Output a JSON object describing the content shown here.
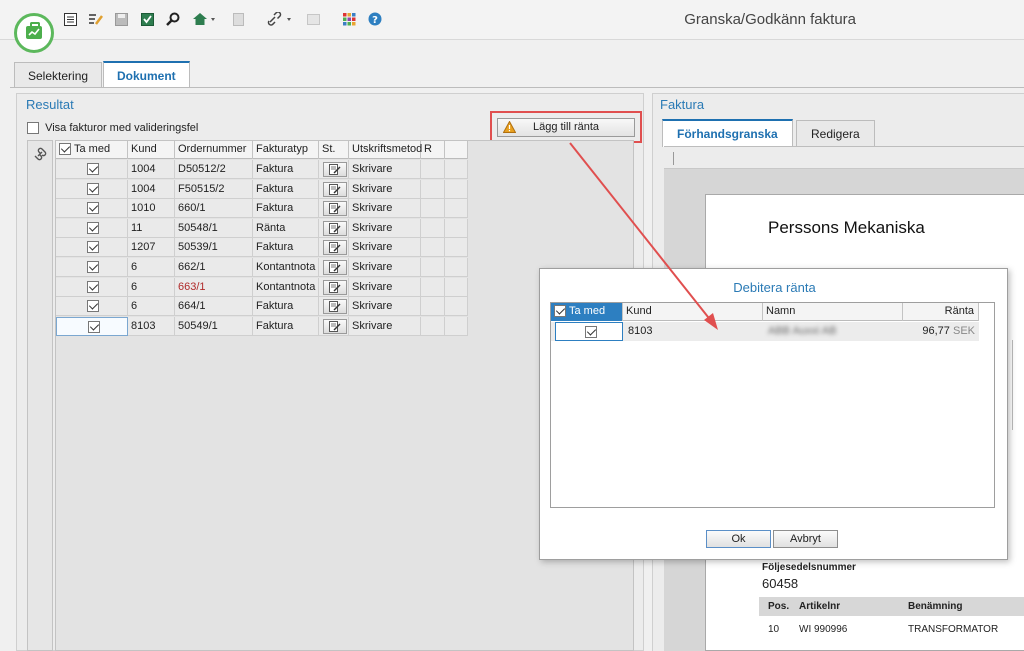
{
  "app": {
    "title": "Granska/Godkänn faktura"
  },
  "toolbar": {
    "icons": [
      "list-icon",
      "edit-list-icon",
      "save-icon",
      "approve-icon",
      "search-icon",
      "home-icon",
      "disabled-icon",
      "link-icon",
      "disabled-icon-2",
      "apps-grid-icon",
      "help-icon"
    ]
  },
  "tabs": {
    "selektering": "Selektering",
    "dokument": "Dokument"
  },
  "resultat": {
    "title": "Resultat",
    "validation_checkbox_label": "Visa fakturor med valideringsfel",
    "add_interest_button": "Lägg till ränta",
    "columns": [
      "Ta med",
      "Kund",
      "Ordernummer",
      "Fakturatyp",
      "St.",
      "Utskriftsmetod",
      "R"
    ],
    "rows": [
      {
        "checked": true,
        "kund": "1004",
        "order": "D50512/2",
        "typ": "Faktura",
        "metod": "Skrivare",
        "order_red": false
      },
      {
        "checked": true,
        "kund": "1004",
        "order": "F50515/2",
        "typ": "Faktura",
        "metod": "Skrivare",
        "order_red": false
      },
      {
        "checked": true,
        "kund": "1010",
        "order": "660/1",
        "typ": "Faktura",
        "metod": "Skrivare",
        "order_red": false
      },
      {
        "checked": true,
        "kund": "11",
        "order": "50548/1",
        "typ": "Ränta",
        "metod": "Skrivare",
        "order_red": false
      },
      {
        "checked": true,
        "kund": "1207",
        "order": "50539/1",
        "typ": "Faktura",
        "metod": "Skrivare",
        "order_red": false
      },
      {
        "checked": true,
        "kund": "6",
        "order": "662/1",
        "typ": "Kontantnota",
        "metod": "Skrivare",
        "order_red": false
      },
      {
        "checked": true,
        "kund": "6",
        "order": "663/1",
        "typ": "Kontantnota",
        "metod": "Skrivare",
        "order_red": true
      },
      {
        "checked": true,
        "kund": "6",
        "order": "664/1",
        "typ": "Faktura",
        "metod": "Skrivare",
        "order_red": false
      },
      {
        "checked": true,
        "kund": "8103",
        "order": "50549/1",
        "typ": "Faktura",
        "metod": "Skrivare",
        "order_red": false
      }
    ]
  },
  "faktura": {
    "title": "Faktura",
    "tabs": {
      "preview": "Förhandsgranska",
      "edit": "Redigera"
    },
    "company": "Perssons Mekaniska",
    "foljesedel_label": "Följesedelsnummer",
    "foljesedel_value": "60458",
    "table_headers": {
      "pos": "Pos.",
      "artikel": "Artikelnr",
      "benamning": "Benämning"
    },
    "table_row": {
      "pos": "10",
      "artikel": "WI 990996",
      "benamning": "TRANSFORMATOR"
    }
  },
  "dialog": {
    "title": "Debitera ränta",
    "columns": {
      "ta_med": "Ta med",
      "kund": "Kund",
      "namn": "Namn",
      "ranta": "Ränta"
    },
    "row": {
      "checked": true,
      "kund": "8103",
      "namn": "ABB Auxxi AB",
      "ranta": "96,77",
      "currency": "SEK"
    },
    "ok": "Ok",
    "cancel": "Avbryt"
  },
  "colors": {
    "accent": "#1e70b0",
    "highlight_red": "#e04f4f",
    "logo_green": "#4cae4c"
  }
}
